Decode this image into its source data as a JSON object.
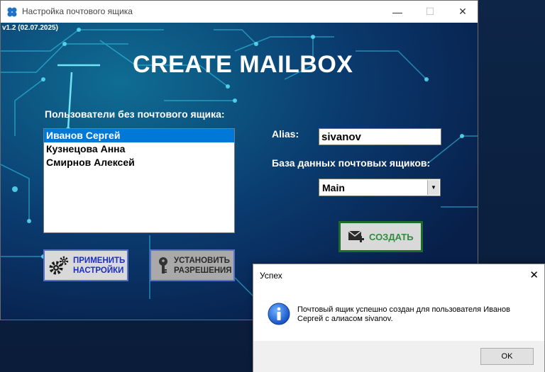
{
  "window": {
    "title": "Настройка почтового ящика",
    "controls": {
      "minimize": "—",
      "maximize": "☐",
      "close": "✕"
    }
  },
  "app": {
    "version": "v1.2 (02.07.2025)",
    "heading": "CREATE MAILBOX"
  },
  "users": {
    "label": "Пользователи без почтового ящика:",
    "items": [
      {
        "name": "Иванов Сергей",
        "selected": true
      },
      {
        "name": "Кузнецова Анна",
        "selected": false
      },
      {
        "name": "Смирнов Алексей",
        "selected": false
      }
    ]
  },
  "alias": {
    "label": "Alias:",
    "value": "sivanov"
  },
  "database": {
    "label": "База данных почтовых ящиков:",
    "value": "Main"
  },
  "buttons": {
    "create": "СОЗДАТЬ",
    "apply_line1": "ПРИМЕНИТЬ",
    "apply_line2": "НАСТРОЙКИ",
    "perm_line1": "УСТАНОВИТЬ",
    "perm_line2": "РАЗРЕШЕНИЯ"
  },
  "dialog": {
    "title": "Успех",
    "close": "✕",
    "message": "Почтовый ящик успешно создан для пользователя Иванов Сергей с алиасом sivanov.",
    "ok": "OK"
  },
  "colors": {
    "accent_selection": "#0078d7",
    "create_border": "#1e6b2a",
    "create_text": "#2f8d3e",
    "apply_text": "#1c2ec0",
    "button_border": "#5a70c8"
  },
  "icons": [
    "app-icon",
    "gears-icon",
    "key-icon",
    "mail-add-icon",
    "info-icon"
  ]
}
